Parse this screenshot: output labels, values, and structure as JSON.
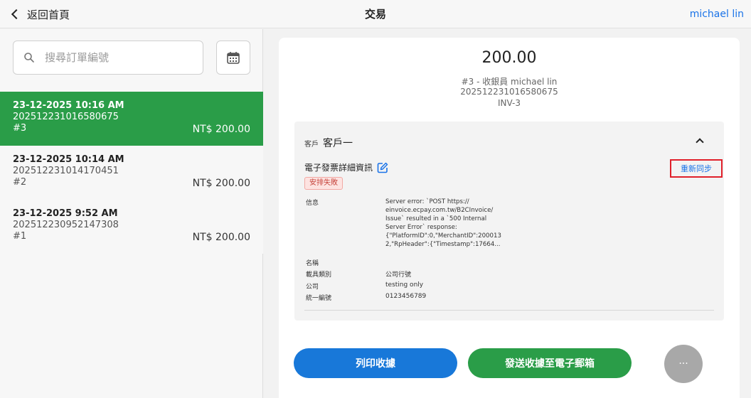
{
  "topbar": {
    "back_label": "返回首頁",
    "title": "交易",
    "user": "michael lin"
  },
  "search": {
    "placeholder": "搜尋訂單編號"
  },
  "orders": [
    {
      "date": "23-12-2025 10:16 AM",
      "number": "202512231016580675",
      "index": "#3",
      "amount": "NT$ 200.00",
      "active": true
    },
    {
      "date": "23-12-2025 10:14 AM",
      "number": "202512231014170451",
      "index": "#2",
      "amount": "NT$ 200.00",
      "active": false
    },
    {
      "date": "23-12-2025 9:52 AM",
      "number": "202512230952147308",
      "index": "#1",
      "amount": "NT$ 200.00",
      "active": false
    }
  ],
  "detail": {
    "total": "200.00",
    "cashier_line": "#3 - 收銀員 michael lin",
    "order_number": "202512231016580675",
    "invoice": "INV-3",
    "customer_label": "客戶",
    "customer_name": "客戶一",
    "einvoice_title": "電子發票詳細資訊",
    "resync_label": "重新同步",
    "status": "安排失敗",
    "fields": {
      "message_label": "信息",
      "message_value": "Server error: `POST https://\neinvoice.ecpay.com.tw/B2CInvoice/\nIssue` resulted in a `500 Internal\nServer Error` response:\n{\"PlatformID\":0,\"MerchantID\":200013\n2,\"RpHeader\":{\"Timestamp\":17664...",
      "name_label": "名稱",
      "carrier_label": "載具類別",
      "carrier_value": "公司行號",
      "company_label": "公司",
      "company_value": "testing only",
      "tax_id_label": "統一編號",
      "tax_id_value": "0123456789"
    }
  },
  "actions": {
    "print_label": "列印收據",
    "email_label": "發送收據至電子郵箱",
    "more_label": "···"
  },
  "colors": {
    "accent_green": "#2a9d48",
    "accent_blue": "#1878d9",
    "link_blue": "#1a73e8",
    "highlight_red": "#e0202a"
  }
}
